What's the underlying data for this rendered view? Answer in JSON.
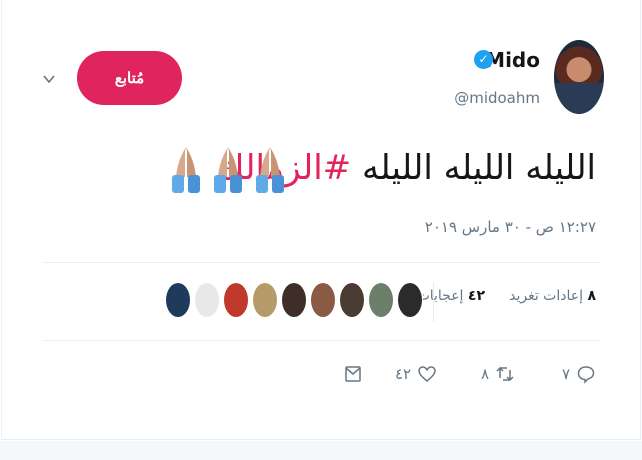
{
  "tweet": {
    "display_name": "Mido",
    "handle": "@midoahm",
    "follow_label": "مُتابع",
    "text_plain": "الليله الليله الليله ",
    "hashtag": "#الزمالك",
    "timestamp": "١٢:٢٧ ص - ٣٠ مارس ٢٠١٩"
  },
  "stats": {
    "retweets_count": "٨",
    "retweets_label": "إعادات تغريد",
    "likes_count": "٤٢",
    "likes_label": "إعجابات"
  },
  "actions": {
    "reply_count": "٧",
    "retweet_count": "٨",
    "like_count": "٤٢"
  },
  "icons": {
    "verified": "verified-icon",
    "chevron": "chevron-down-icon",
    "reply": "reply-icon",
    "retweet": "retweet-icon",
    "like": "heart-icon",
    "message": "envelope-icon",
    "emoji": "folded-hands-emoji"
  },
  "colors": {
    "accent": "#e0245e",
    "verified": "#1da1f2",
    "muted": "#657786"
  }
}
